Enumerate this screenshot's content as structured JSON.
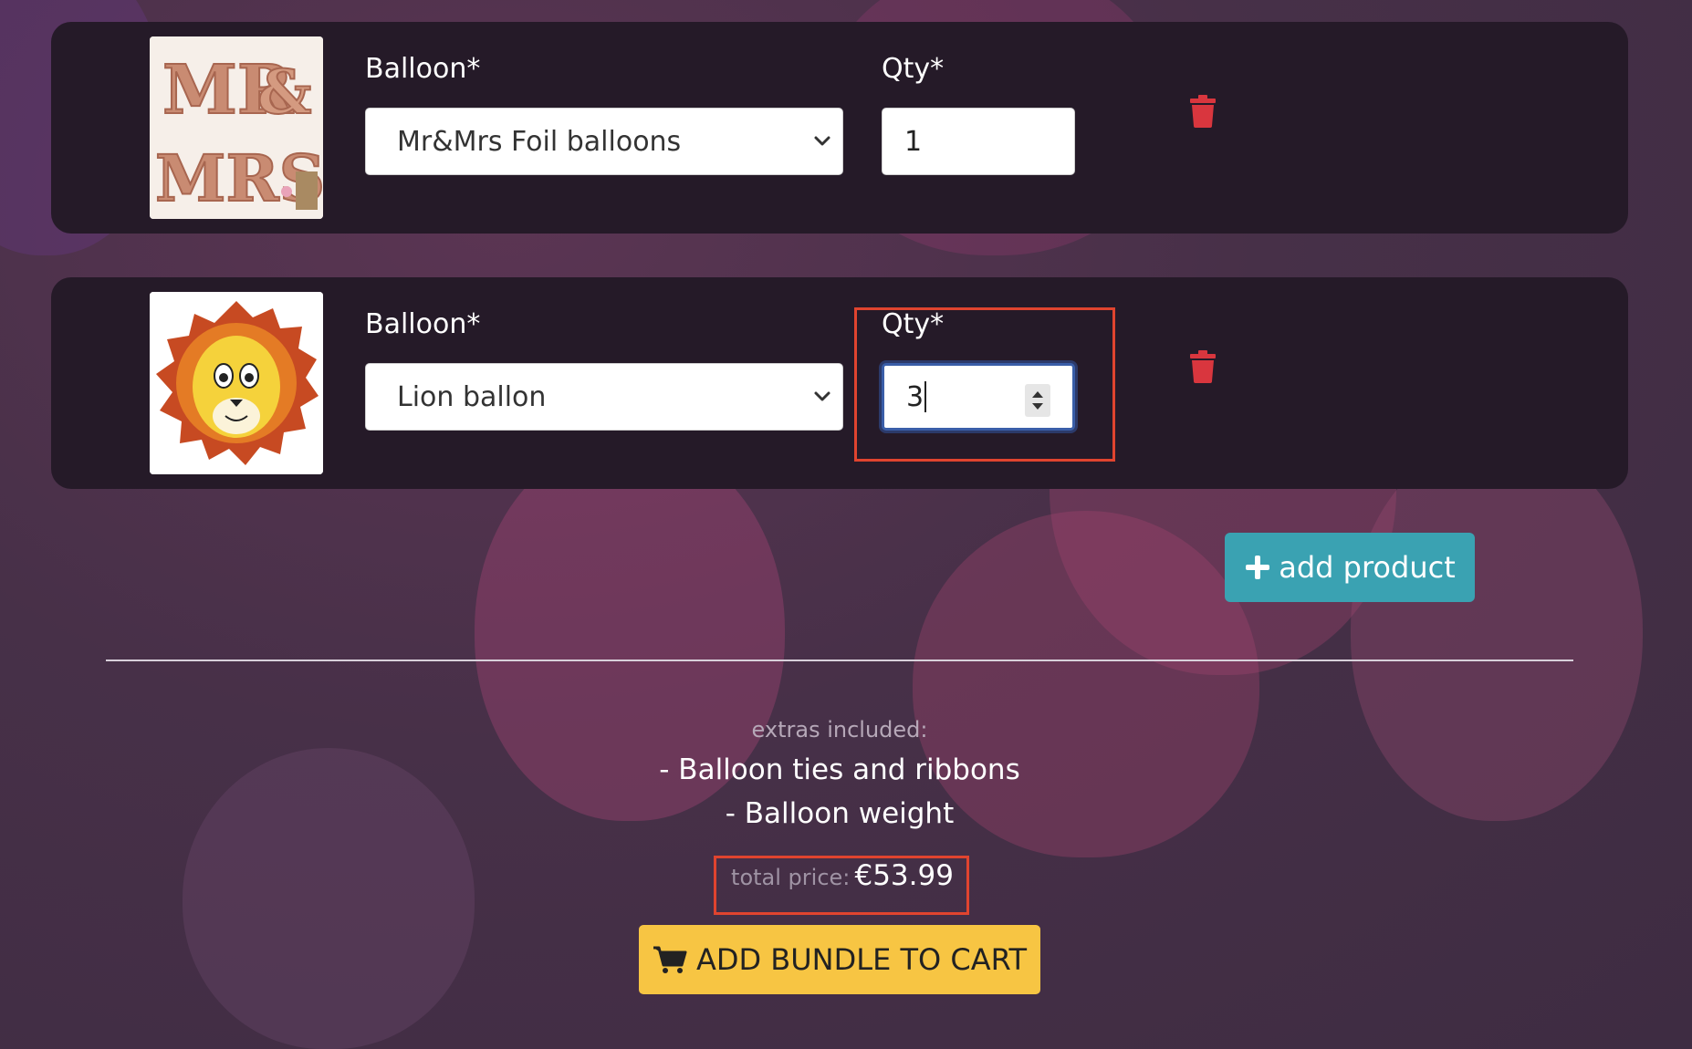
{
  "colors": {
    "card_bg": "#251a28",
    "accent_teal": "#3aa2b2",
    "cta_yellow": "#f7c543",
    "trash_red": "#d9363e",
    "highlight_red": "#e0442f"
  },
  "items": [
    {
      "balloon_label": "Balloon*",
      "balloon_value": "Mr&Mrs Foil balloons",
      "qty_label": "Qty*",
      "qty_value": "1",
      "image_icon": "mr-mrs-foil-balloons-image",
      "delete_icon": "trash-icon"
    },
    {
      "balloon_label": "Balloon*",
      "balloon_value": "Lion ballon",
      "qty_label": "Qty*",
      "qty_value": "3",
      "image_icon": "lion-balloon-image",
      "delete_icon": "trash-icon"
    }
  ],
  "add_product": {
    "icon": "plus-icon",
    "label": "add product"
  },
  "extras": {
    "title": "extras included:",
    "lines": [
      "- Balloon ties and ribbons",
      "- Balloon weight"
    ]
  },
  "price": {
    "label": "total price:",
    "value": "€53.99"
  },
  "cart": {
    "icon": "cart-icon",
    "label": "ADD BUNDLE TO CART"
  }
}
